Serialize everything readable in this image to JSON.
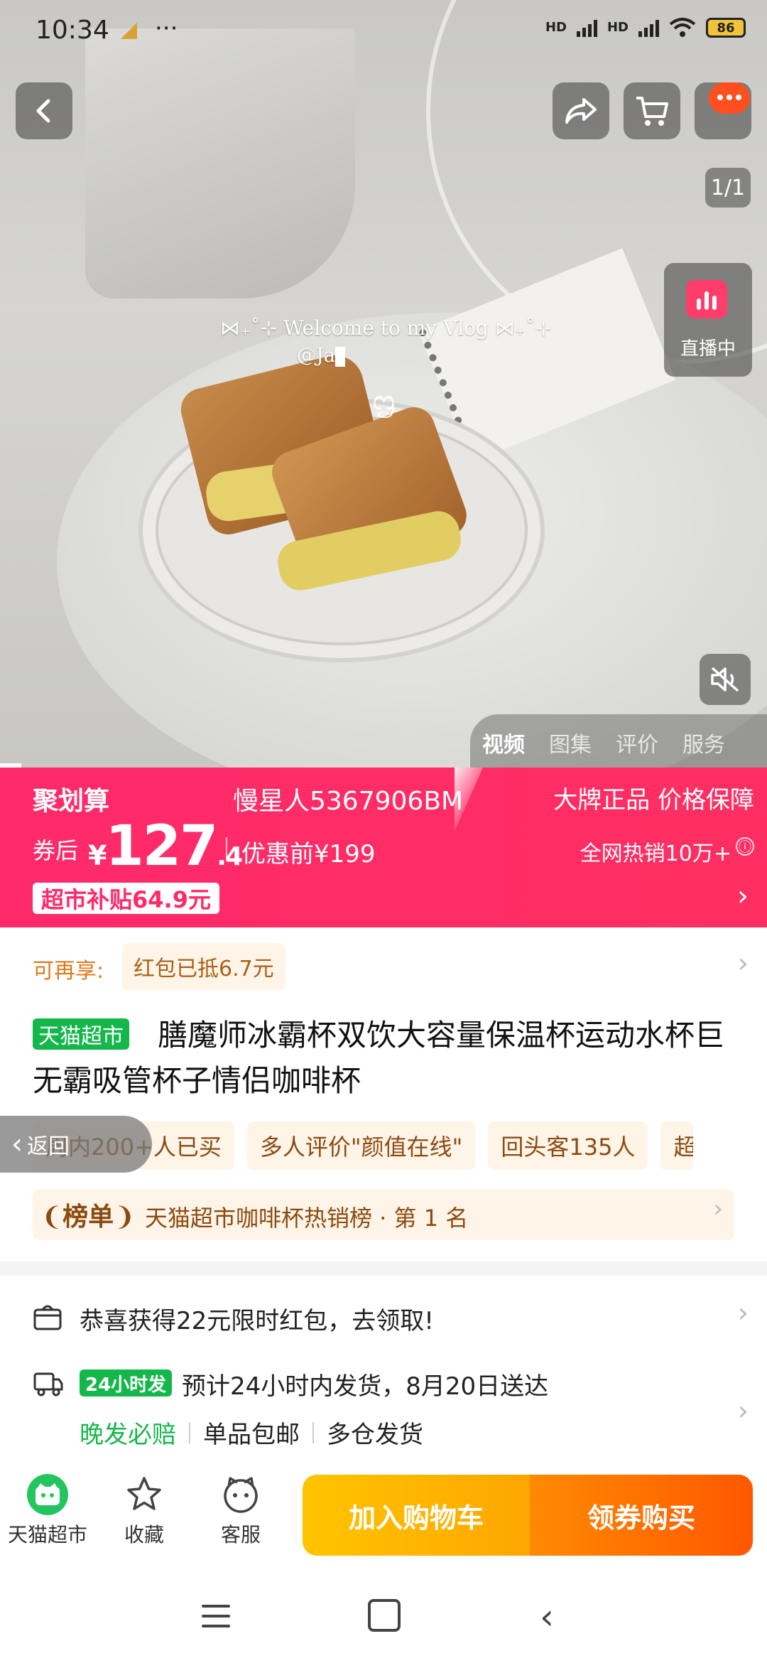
{
  "status": {
    "time": "10:34",
    "dots": "···",
    "hd1": "HD",
    "hd2": "HD",
    "battery": "86"
  },
  "hero": {
    "overlay_line1": "⋈₊˚⊹ Welcome to my Vlog ⋈₊˚⊹",
    "overlay_line2": "@Ja",
    "page_indicator": "1/1",
    "live_label": "直播中",
    "media_tabs": [
      "视频",
      "图集",
      "评价",
      "服务"
    ],
    "active_tab": "视频",
    "icons": [
      "back-icon",
      "share-icon",
      "cart-icon",
      "chat-icon",
      "mute-icon"
    ]
  },
  "promo": {
    "juhuasuan": "聚划算",
    "buyer": "慢星人5367906BM",
    "brand_guarantee": "大牌正品 价格保障",
    "after_label": "券后",
    "currency": "¥",
    "price_int": "127",
    "price_dec": ".4",
    "price_before": "优惠前¥199",
    "hot_sales": "全网热销10万+",
    "info_icon": "ⓘ",
    "subsidy": "超市补贴64.9元",
    "color": "#ff2a6a"
  },
  "product": {
    "redeem_label": "可再享:",
    "redeem_tag": "红包已抵6.7元",
    "store_badge": "天猫超市",
    "title": "膳魔师冰霸杯双饮大容量保温杯运动水杯巨无霸吸管杯子情侣咖啡杯",
    "tags": [
      "周内200+人已买",
      "多人评价\"颜值在线\"",
      "回头客135人",
      "超"
    ],
    "back_pill": "返回",
    "rank_badge": "榜单",
    "rank_text": "天猫超市咖啡杯热销榜 · 第 1 名"
  },
  "service": {
    "coupon_text": "恭喜获得22元限时红包，去领取!",
    "badge_24h": "24小时发",
    "ship_text": "预计24小时内发货，8月20日送达",
    "ship_sub": [
      "晚发必赔",
      "单品包邮",
      "多仓发货"
    ]
  },
  "bottom_bar": {
    "store": "天猫超市",
    "favorite": "收藏",
    "service": "客服",
    "add_cart": "加入购物车",
    "buy": "领券购买"
  }
}
